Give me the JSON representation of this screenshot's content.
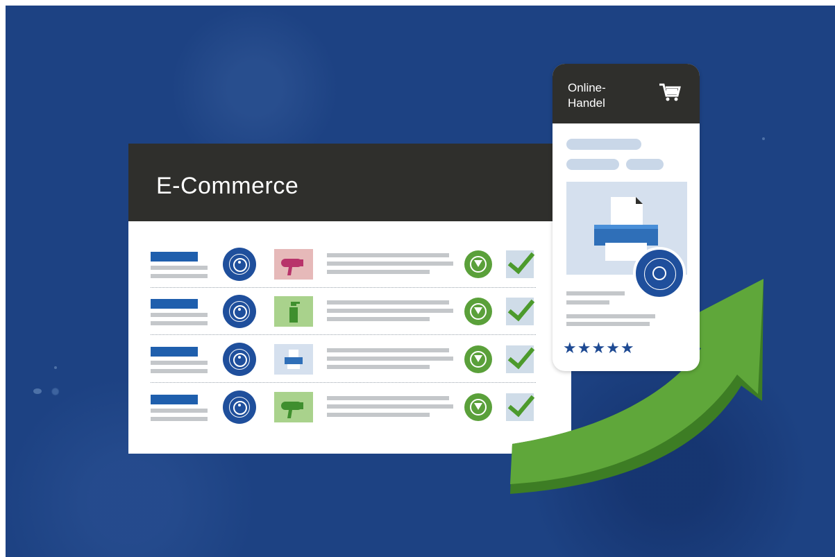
{
  "desktop_window": {
    "title": "E-Commerce",
    "rows": [
      {
        "product_icon": "hair-dryer-icon",
        "product_bg": "#e6b9b9"
      },
      {
        "product_icon": "spray-bottle-icon",
        "product_bg": "#a9d28c"
      },
      {
        "product_icon": "printer-icon",
        "product_bg": "#d5e0ee"
      },
      {
        "product_icon": "hair-dryer-icon",
        "product_bg": "#a9d28c"
      }
    ]
  },
  "phone": {
    "title": "Online-Handel",
    "cart_icon": "shopping-cart-icon",
    "stars": "★★★★★",
    "rating": 5
  },
  "colors": {
    "background": "#1d4283",
    "header": "#2f2f2c",
    "accent_blue": "#1f5fad",
    "green": "#5aa03a"
  }
}
